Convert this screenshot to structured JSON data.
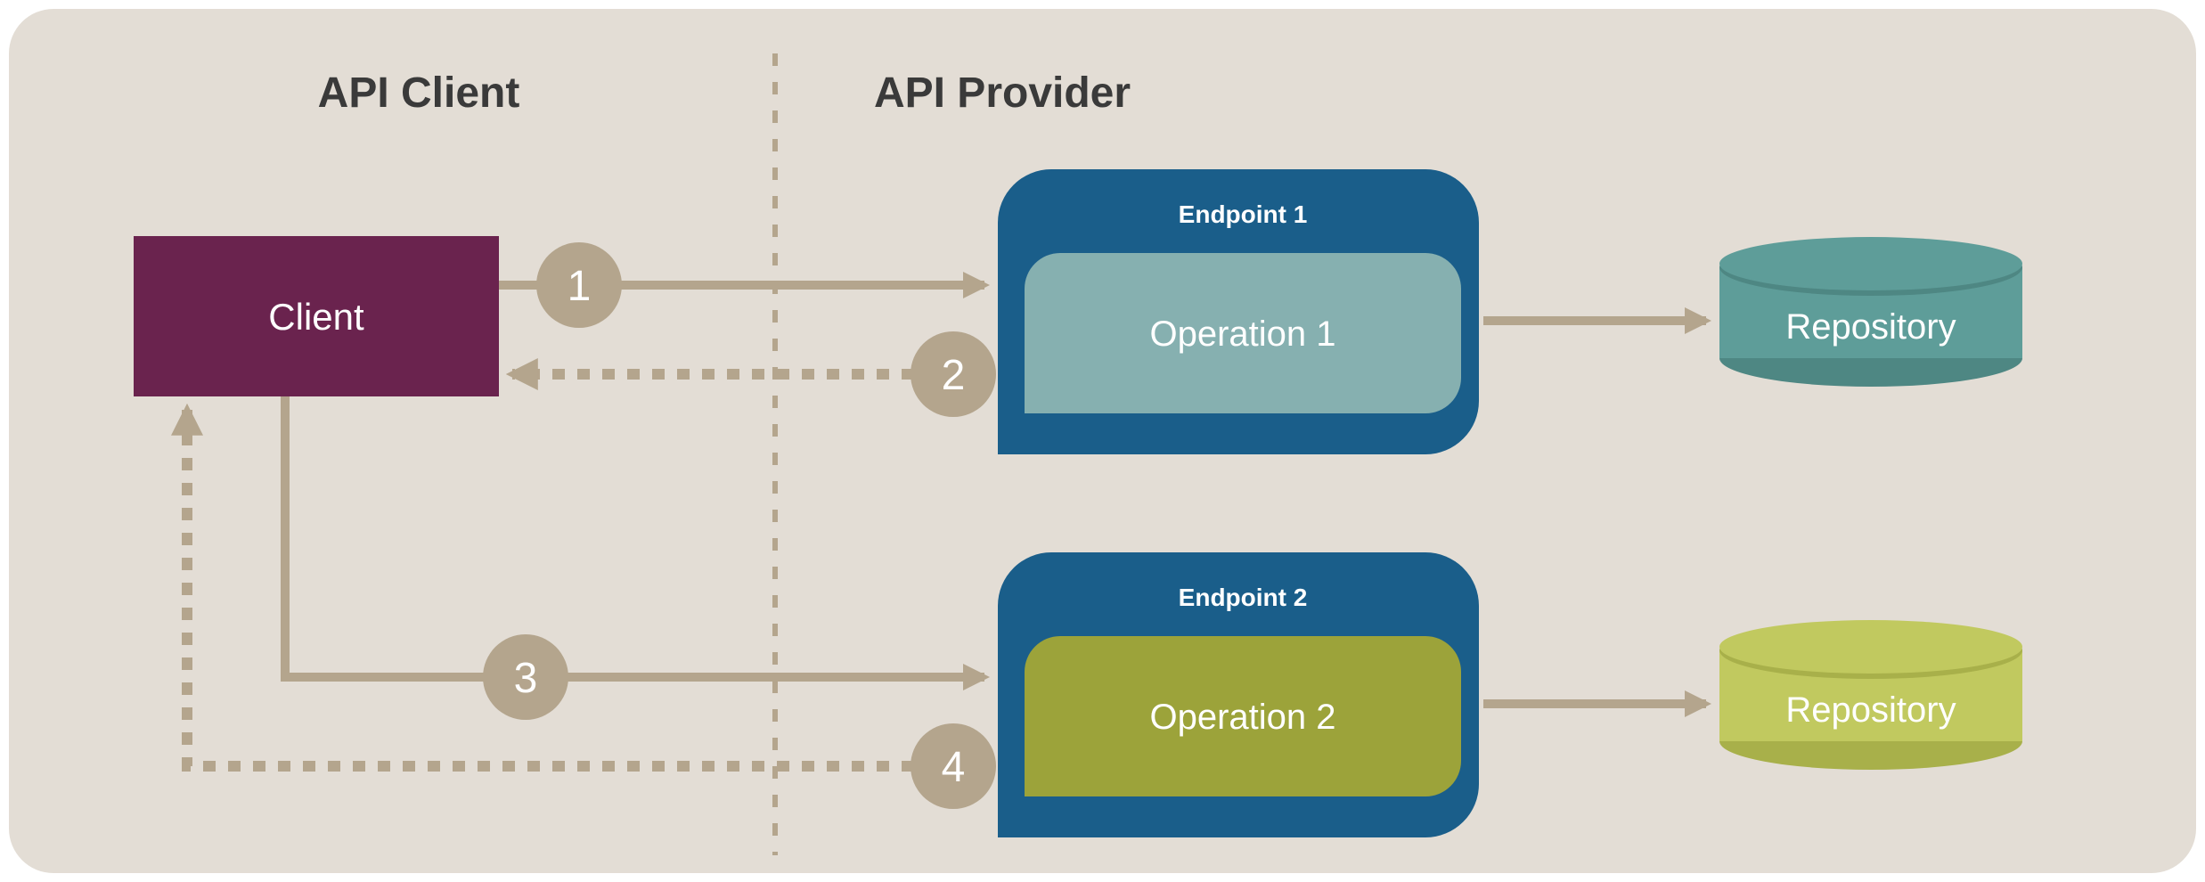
{
  "titles": {
    "left": "API Client",
    "right": "API Provider"
  },
  "client": {
    "label": "Client"
  },
  "endpoints": [
    {
      "title": "Endpoint 1",
      "operation": "Operation 1"
    },
    {
      "title": "Endpoint 2",
      "operation": "Operation 2"
    }
  ],
  "repositories": [
    {
      "label": "Repository"
    },
    {
      "label": "Repository"
    }
  ],
  "steps": {
    "n1": "1",
    "n2": "2",
    "n3": "3",
    "n4": "4"
  }
}
